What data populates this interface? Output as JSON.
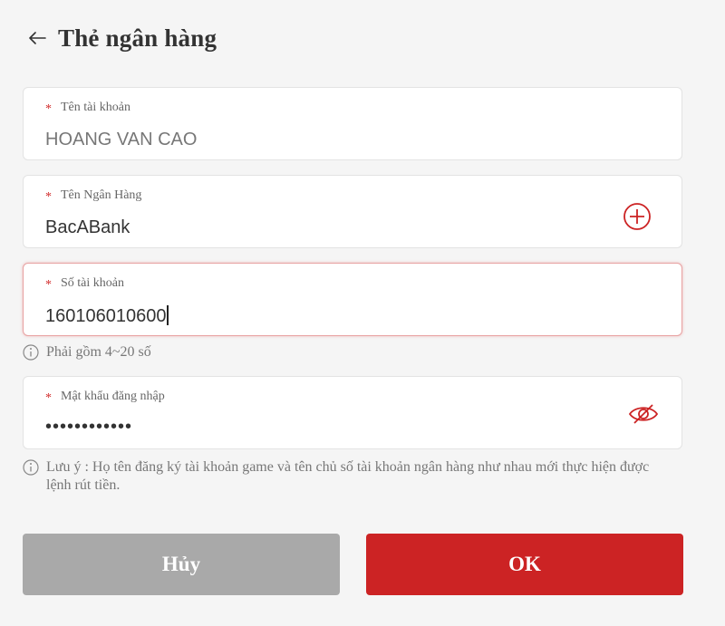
{
  "header": {
    "title": "Thẻ ngân hàng",
    "back_icon": "arrow-left-icon"
  },
  "fields": {
    "account_name": {
      "required_mark": "*",
      "label": "Tên tài khoản",
      "value": "HOANG VAN CAO"
    },
    "bank_name": {
      "required_mark": "*",
      "label": "Tên Ngân Hàng",
      "value": "BacABank",
      "action_icon": "plus-circle-icon"
    },
    "account_number": {
      "required_mark": "*",
      "label": "Số tài khoản",
      "value": "160106010600",
      "hint": "Phải gồm 4~20 số"
    },
    "password": {
      "required_mark": "*",
      "label": "Mật khẩu đăng nhập",
      "value": "••••••••••••",
      "action_icon": "eye-off-icon"
    }
  },
  "note": "Lưu ý : Họ tên đăng ký tài khoản game và tên chủ số tài khoản ngân hàng như nhau mới thực hiện được lệnh rút tiền.",
  "buttons": {
    "cancel": "Hủy",
    "ok": "OK"
  },
  "colors": {
    "accent": "#cc2324",
    "cancel": "#a9a9a9",
    "background": "#f5f5f5",
    "required": "#d22b2b"
  }
}
